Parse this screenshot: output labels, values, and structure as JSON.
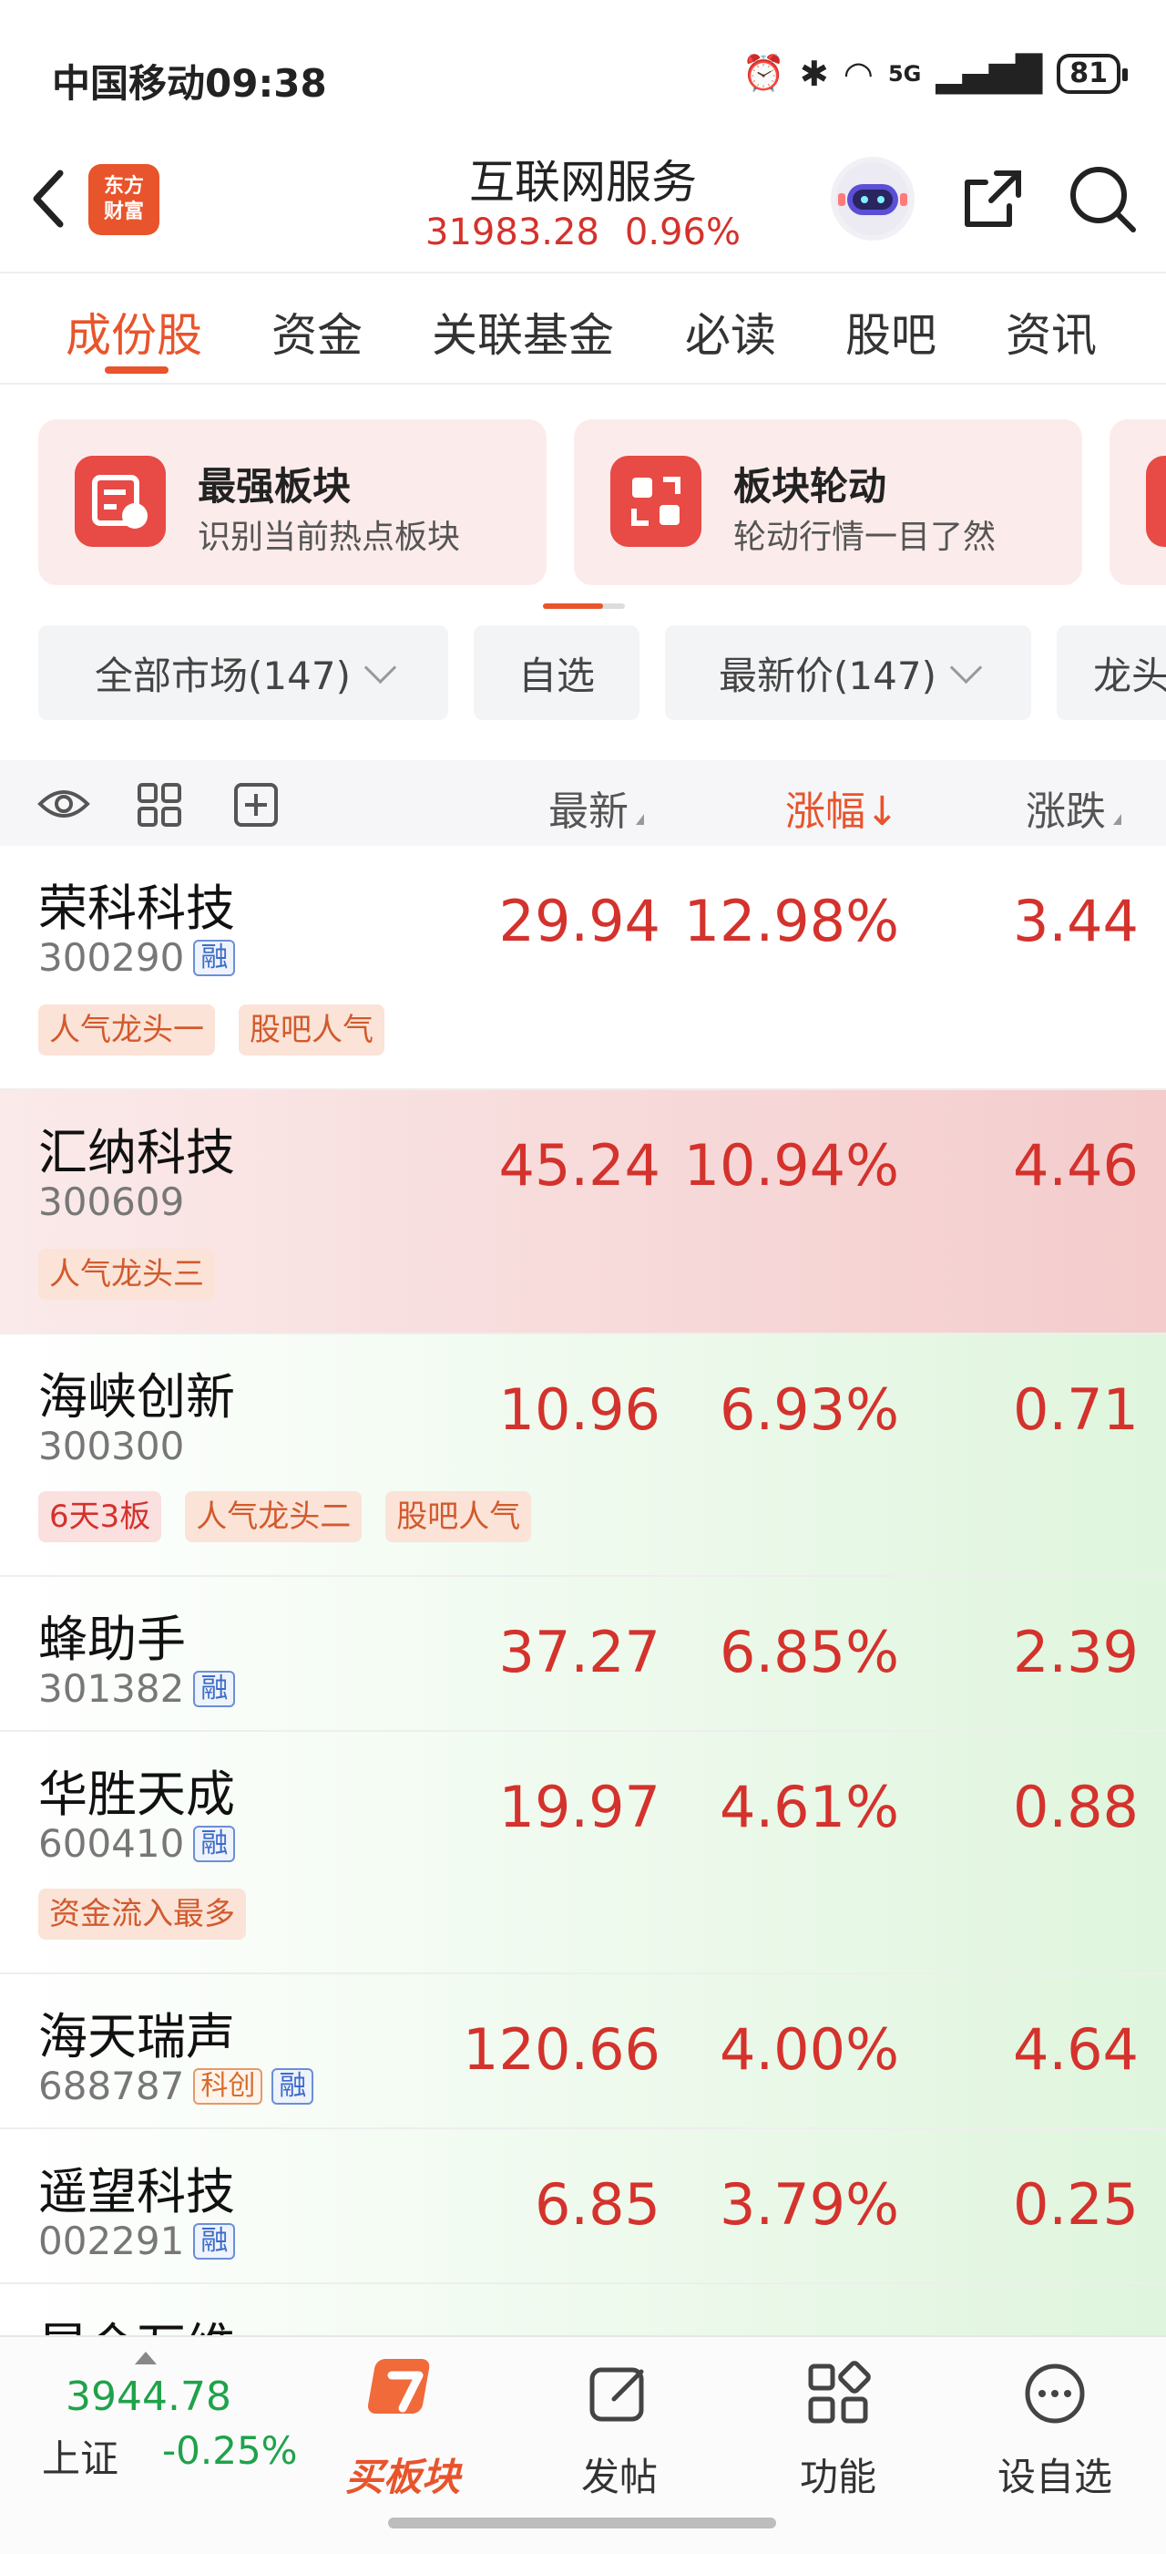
{
  "status_bar": {
    "carrier": "中国移动",
    "time": "09:38",
    "network": "5G",
    "battery": "81"
  },
  "header": {
    "title": "互联网服务",
    "index_value": "31983.28",
    "index_change": "0.96%",
    "logo_text": "东方财富"
  },
  "tabs": [
    {
      "label": "成份股",
      "active": true
    },
    {
      "label": "资金"
    },
    {
      "label": "关联基金"
    },
    {
      "label": "必读"
    },
    {
      "label": "股吧"
    },
    {
      "label": "资讯"
    }
  ],
  "cards": [
    {
      "title": "最强板块",
      "desc": "识别当前热点板块",
      "icon": "board-thumb-icon"
    },
    {
      "title": "板块轮动",
      "desc": "轮动行情一目了然",
      "icon": "rotation-icon"
    }
  ],
  "filters": [
    {
      "label": "全部市场(147)",
      "dropdown": true
    },
    {
      "label": "自选",
      "dropdown": false
    },
    {
      "label": "最新价(147)",
      "dropdown": true
    },
    {
      "label": "龙头",
      "dropdown": false
    }
  ],
  "table_header": {
    "latest": "最新",
    "change_pct": "涨幅↓",
    "change": "涨跌"
  },
  "stocks": [
    {
      "name": "荣科科技",
      "code": "300290",
      "badges": [
        "融"
      ],
      "price": "29.94",
      "pct": "12.98%",
      "chg": "3.44",
      "tags": [
        {
          "text": "人气龙头一"
        },
        {
          "text": "股吧人气"
        }
      ]
    },
    {
      "name": "汇纳科技",
      "code": "300609",
      "badges": [],
      "price": "45.24",
      "pct": "10.94%",
      "chg": "4.46",
      "tags": [
        {
          "text": "人气龙头三"
        }
      ]
    },
    {
      "name": "海峡创新",
      "code": "300300",
      "badges": [],
      "price": "10.96",
      "pct": "6.93%",
      "chg": "0.71",
      "tags": [
        {
          "text": "6天3板"
        },
        {
          "text": "人气龙头二"
        },
        {
          "text": "股吧人气"
        }
      ]
    },
    {
      "name": "蜂助手",
      "code": "301382",
      "badges": [
        "融"
      ],
      "price": "37.27",
      "pct": "6.85%",
      "chg": "2.39",
      "tags": []
    },
    {
      "name": "华胜天成",
      "code": "600410",
      "badges": [
        "融"
      ],
      "price": "19.97",
      "pct": "4.61%",
      "chg": "0.88",
      "tags": [
        {
          "text": "资金流入最多"
        }
      ]
    },
    {
      "name": "海天瑞声",
      "code": "688787",
      "badges": [
        "科创",
        "融"
      ],
      "price": "120.66",
      "pct": "4.00%",
      "chg": "4.64",
      "tags": []
    },
    {
      "name": "遥望科技",
      "code": "002291",
      "badges": [
        "融"
      ],
      "price": "6.85",
      "pct": "3.79%",
      "chg": "0.25",
      "tags": []
    },
    {
      "name": "昆仑万维",
      "code": "",
      "badges": [],
      "price": "",
      "pct": "",
      "chg": "",
      "tags": []
    }
  ],
  "bottom_bar": {
    "index_value": "3944.78",
    "index_name": "上证",
    "index_change": "-0.25%",
    "nav": [
      {
        "label": "买板块",
        "icon": "buy-board-icon"
      },
      {
        "label": "发帖",
        "icon": "compose-icon"
      },
      {
        "label": "功能",
        "icon": "apps-icon"
      },
      {
        "label": "设自选",
        "icon": "more-circle-icon"
      }
    ]
  },
  "colors": {
    "accent": "#e8542b",
    "up": "#d4322c",
    "down": "#1fa24a"
  }
}
